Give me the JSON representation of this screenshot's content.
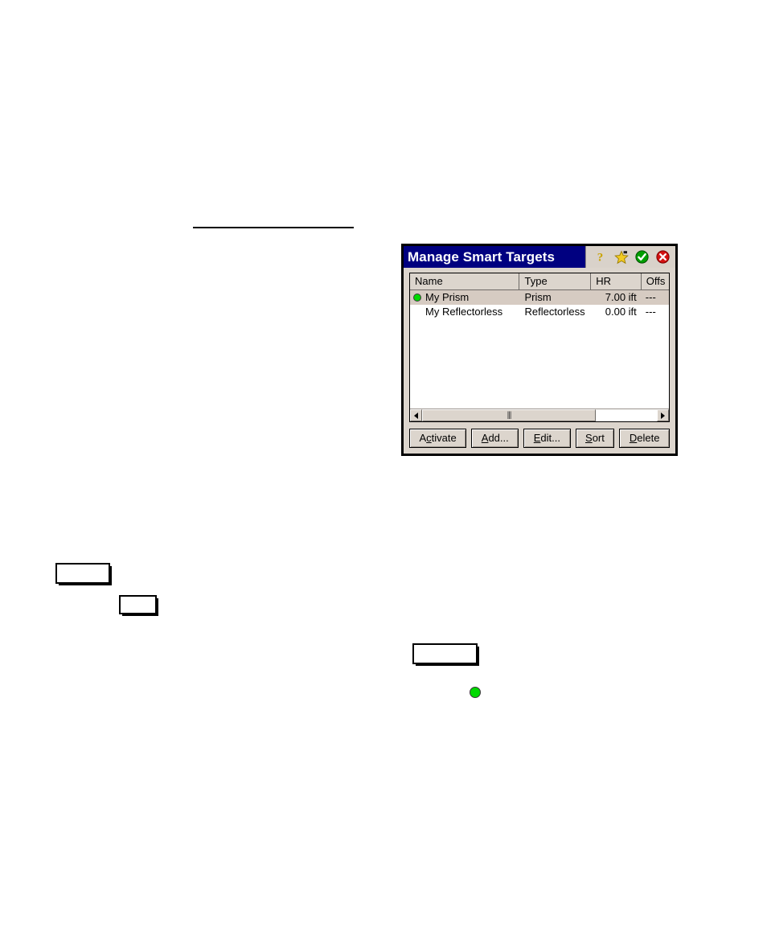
{
  "page": {
    "background": "#ffffff",
    "rule": {
      "present": true
    }
  },
  "placeholders": {
    "boxes": [
      {
        "name": "empty-box-1"
      },
      {
        "name": "empty-box-2"
      },
      {
        "name": "empty-box-3"
      }
    ],
    "standalone_marker": {
      "name": "green-status-dot",
      "color": "#00d900"
    }
  },
  "dialog": {
    "title": "Manage Smart Targets",
    "title_bar_color": "#000080",
    "title_text_color": "#ffffff",
    "background": "#dcd5cd",
    "title_icons": [
      {
        "name": "help-icon",
        "glyph": "?",
        "color": "#d8b400"
      },
      {
        "name": "favorites-star-icon",
        "glyph": "star",
        "color": "#f5d020"
      },
      {
        "name": "ok-check-icon",
        "glyph": "check",
        "color": "#00a000"
      },
      {
        "name": "close-icon",
        "glyph": "x",
        "color": "#d00000"
      }
    ],
    "list": {
      "columns": [
        {
          "key": "name",
          "label": "Name"
        },
        {
          "key": "type",
          "label": "Type"
        },
        {
          "key": "hr",
          "label": "HR"
        },
        {
          "key": "offset",
          "label": "Offs"
        }
      ],
      "rows": [
        {
          "name": "My Prism",
          "type": "Prism",
          "hr": "7.00 ift",
          "offset": "---",
          "active": true,
          "selected": true
        },
        {
          "name": "My Reflectorless",
          "type": "Reflectorless",
          "hr": "0.00 ift",
          "offset": "---",
          "active": false,
          "selected": false
        }
      ],
      "selection_color": "#d6cbc2",
      "active_marker_color": "#00d900"
    },
    "scrollbar": {
      "orientation": "horizontal",
      "left_arrow": "left-arrow",
      "right_arrow": "right-arrow",
      "grip": "|||"
    },
    "buttons": [
      {
        "name": "activate",
        "pre": "A",
        "accel": "c",
        "post": "tivate"
      },
      {
        "name": "add",
        "pre": "",
        "accel": "A",
        "post": "dd..."
      },
      {
        "name": "edit",
        "pre": "",
        "accel": "E",
        "post": "dit..."
      },
      {
        "name": "sort",
        "pre": "",
        "accel": "S",
        "post": "ort"
      },
      {
        "name": "delete",
        "pre": "",
        "accel": "D",
        "post": "elete"
      }
    ]
  }
}
